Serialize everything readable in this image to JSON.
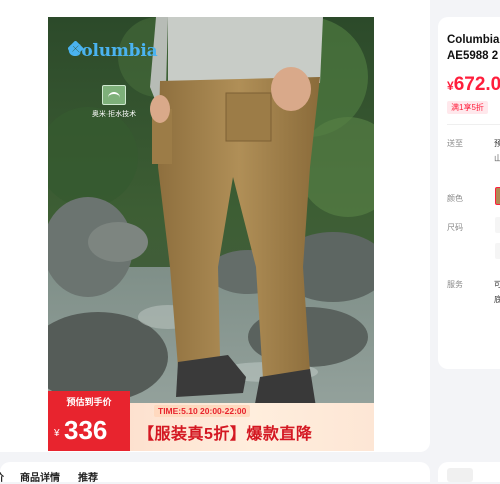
{
  "gallery": {
    "brand": "Columbia",
    "tech_badge": "奥米·拒水技术",
    "promo": {
      "tag": "预估到手价",
      "currency": "¥",
      "amount": "336",
      "time": "TIME:5.10 20:00-22:00",
      "headline": "【服装真5折】爆款直降"
    }
  },
  "tabs": [
    "商品详情",
    "推荐"
  ],
  "product": {
    "title_line1": "Columbia",
    "title_line2": "AE5988 2",
    "price_currency": "¥",
    "price_value": "672.0",
    "discount_tag": "满1享5折",
    "attributes": {
      "ship_label": "送至",
      "color_label": "颜色",
      "size_label": "尺码",
      "service_label": "服务"
    }
  },
  "colors": {
    "accent": "#ff1e3c",
    "promo_red": "#e8242e",
    "brand_blue": "#4ab3f0",
    "pants": "#a8874f"
  }
}
